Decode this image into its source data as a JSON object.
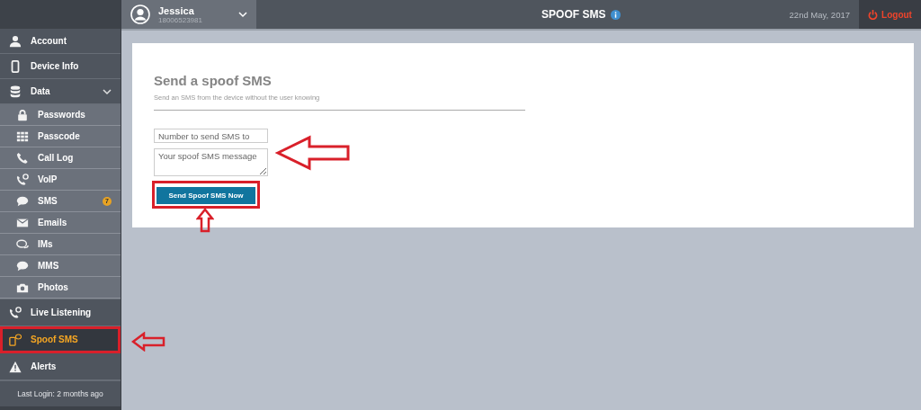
{
  "user": {
    "name": "Jessica",
    "phone": "18006523981"
  },
  "header": {
    "title": "SPOOF SMS",
    "date": "22nd May, 2017",
    "logout": "Logout"
  },
  "sidebar": {
    "items": [
      {
        "kind": "main",
        "label": "Account",
        "selected": false
      },
      {
        "kind": "main",
        "label": "Device Info",
        "selected": false
      },
      {
        "kind": "main",
        "label": "Data",
        "selected": false,
        "expanded": true,
        "children": [
          {
            "label": "Passwords",
            "selected": false
          },
          {
            "label": "Passcode",
            "selected": false
          },
          {
            "label": "Call Log",
            "selected": false
          },
          {
            "label": "VoIP",
            "selected": false
          },
          {
            "label": "SMS",
            "selected": false,
            "badge": "7"
          },
          {
            "label": "Emails",
            "selected": false
          },
          {
            "label": "IMs",
            "selected": false
          },
          {
            "label": "MMS",
            "selected": false
          },
          {
            "label": "Photos",
            "selected": false
          }
        ]
      },
      {
        "kind": "main",
        "label": "Live Listening",
        "selected": false
      },
      {
        "kind": "main",
        "label": "Spoof SMS",
        "selected": true,
        "marked": true
      },
      {
        "kind": "main",
        "label": "Alerts",
        "selected": false
      }
    ],
    "last_login": "Last Login: 2 months ago"
  },
  "form": {
    "title": "Send a spoof SMS",
    "subtitle": "Send an SMS from the device without the user knowing",
    "number_field": {
      "placeholder": "Number to send SMS to"
    },
    "message_field": {
      "placeholder": "Your spoof SMS message"
    },
    "fields_marked": true,
    "submit": {
      "label": "Send Spoof SMS Now",
      "marked": true
    }
  }
}
